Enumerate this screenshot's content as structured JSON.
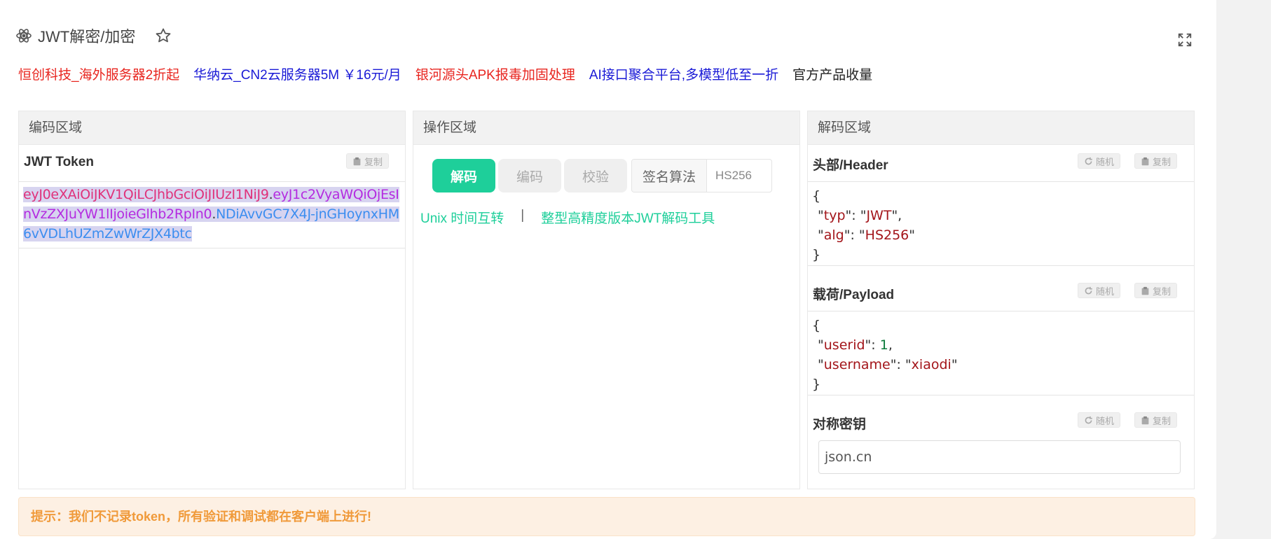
{
  "app": {
    "title": "JWT解密/加密",
    "logo_icon": "atom-icon",
    "star_icon": "star-icon",
    "expand_icon": "fullscreen-icon"
  },
  "ads": [
    {
      "text": "恒创科技_海外服务器2折起",
      "color": "#e8251f"
    },
    {
      "text": "华纳云_CN2云服务器5M ￥16元/月",
      "color": "#1a1ad6"
    },
    {
      "text": "银河源头APK报毒加固处理",
      "color": "#e8251f"
    },
    {
      "text": "AI接口聚合平台,多模型低至一折",
      "color": "#1a1ad6"
    },
    {
      "text": "官方产品收量",
      "color": "#222222"
    }
  ],
  "encode_panel": {
    "title": "编码区域",
    "token_label": "JWT Token",
    "copy_label": "复制",
    "token_header": "eyJ0eXAiOiJKV1QiLCJhbGciOiJIUzI1NiJ9",
    "token_payload": "eyJ1c2VyaWQiOjEsInVzZXJuYW1lIjoieGlhb2RpIn0",
    "token_signature": "NDiAvvGC7X4J-jnGHoynxHM6vVDLhUZmZwWrZJX4btc",
    "dot": "."
  },
  "operate_panel": {
    "title": "操作区域",
    "tabs": [
      {
        "label": "解码",
        "active": true
      },
      {
        "label": "编码",
        "active": false
      },
      {
        "label": "校验",
        "active": false
      }
    ],
    "algo_label": "签名算法",
    "algo_value": "HS256",
    "link_unix": "Unix 时间互转",
    "link_sep": "|",
    "link_bigint": "整型高精度版本JWT解码工具"
  },
  "decode_panel": {
    "title": "解码区域",
    "random_label": "随机",
    "copy_label": "复制",
    "header_label": "头部/Header",
    "header_json": {
      "typ": "JWT",
      "alg": "HS256"
    },
    "payload_label": "载荷/Payload",
    "payload_json": {
      "userid": 1,
      "username": "xiaodi"
    },
    "secret_label": "对称密钥",
    "secret_value": "json.cn"
  },
  "tip": "提示：我们不记录token，所有验证和调试都在客户端上进行!",
  "colors": {
    "accent": "#1ecf9a",
    "tip_bg": "#fdf0e3",
    "tip_text": "#f09a3a"
  }
}
